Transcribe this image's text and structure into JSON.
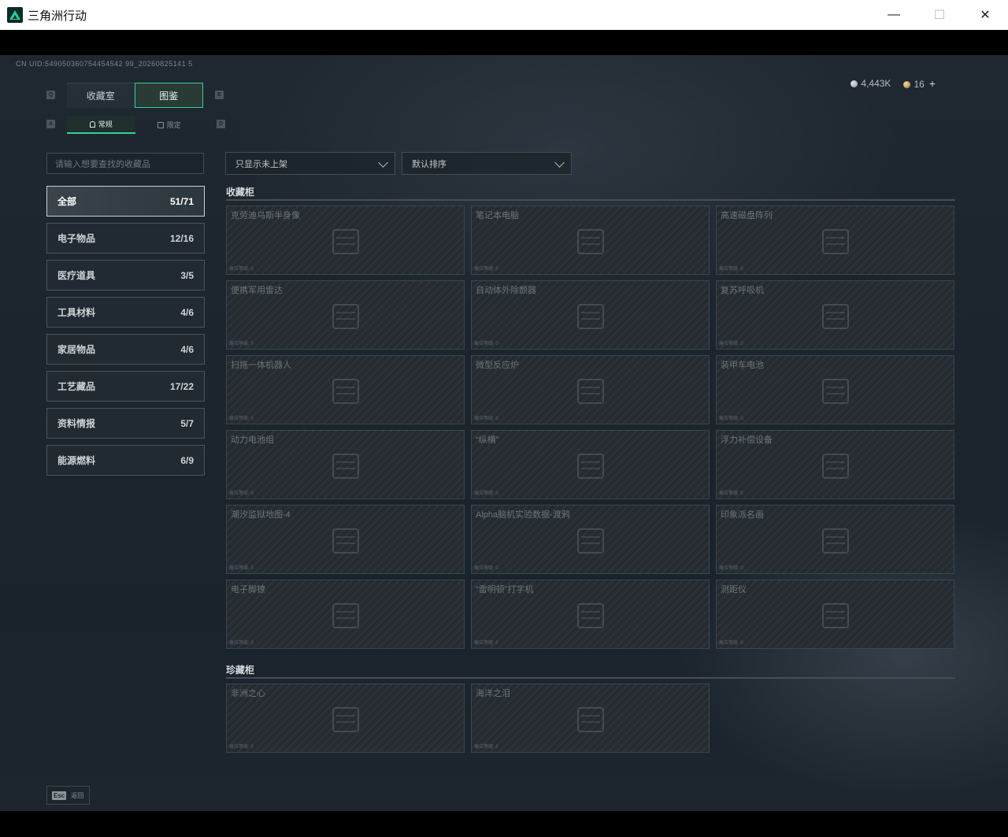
{
  "window": {
    "title": "三角洲行动",
    "minimize": "—",
    "maximize": "☐",
    "close": "✕"
  },
  "uid": "CN UID:549050360754454542 99_20260825141 5",
  "currency": {
    "silver": "4,443K",
    "gold": "16",
    "plus": "+"
  },
  "keys": {
    "tab_left": "Q",
    "tab_right": "E",
    "sub_left": "A",
    "sub_right": "D"
  },
  "main_tabs": [
    "收藏室",
    "图鉴"
  ],
  "sub_tabs": [
    "常规",
    "限定"
  ],
  "search": {
    "placeholder": "请输入想要查找的收藏品"
  },
  "categories": [
    {
      "label": "全部",
      "count": "51/71"
    },
    {
      "label": "电子物品",
      "count": "12/16"
    },
    {
      "label": "医疗道具",
      "count": "3/5"
    },
    {
      "label": "工具材料",
      "count": "4/6"
    },
    {
      "label": "家居物品",
      "count": "4/6"
    },
    {
      "label": "工艺藏品",
      "count": "17/22"
    },
    {
      "label": "资料情报",
      "count": "5/7"
    },
    {
      "label": "能源燃料",
      "count": "6/9"
    }
  ],
  "filters": {
    "show": "只显示未上架",
    "sort": "默认排序"
  },
  "sections": {
    "cabinet": {
      "title": "收藏柜",
      "items": [
        {
          "name": "克劳迪乌斯半身像",
          "level": "展位等级: 0"
        },
        {
          "name": "笔记本电脑",
          "level": "展位等级: 0"
        },
        {
          "name": "高速磁盘阵列",
          "level": "展位等级: 0"
        },
        {
          "name": "便携军用雷达",
          "level": "展位等级: 0"
        },
        {
          "name": "自动体外除颤器",
          "level": "展位等级: 0"
        },
        {
          "name": "复苏呼吸机",
          "level": "展位等级: 0"
        },
        {
          "name": "扫拖一体机器人",
          "level": "展位等级: 0"
        },
        {
          "name": "微型反应炉",
          "level": "展位等级: 0"
        },
        {
          "name": "装甲车电池",
          "level": "展位等级: 0"
        },
        {
          "name": "动力电池组",
          "level": "展位等级: 0"
        },
        {
          "name": "“纵横”",
          "level": "展位等级: 0"
        },
        {
          "name": "浮力补偿设备",
          "level": "展位等级: 0"
        },
        {
          "name": "潮汐监狱地图-4",
          "level": "展位等级: 0"
        },
        {
          "name": "Alpha脑机实验数据-渡鸦",
          "level": "展位等级: 0"
        },
        {
          "name": "印象派名画",
          "level": "展位等级: 0"
        },
        {
          "name": "电子脚镣",
          "level": "展位等级: 0"
        },
        {
          "name": "“雷明顿”打字机",
          "level": "展位等级: 0"
        },
        {
          "name": "测距仪",
          "level": "展位等级: 0"
        }
      ]
    },
    "treasure": {
      "title": "珍藏柜",
      "items": [
        {
          "name": "非洲之心",
          "level": "展位等级: 0"
        },
        {
          "name": "海洋之泪",
          "level": "展位等级: 0"
        }
      ]
    }
  },
  "footer": {
    "esc_key": "Esc",
    "esc_label": "返回"
  }
}
